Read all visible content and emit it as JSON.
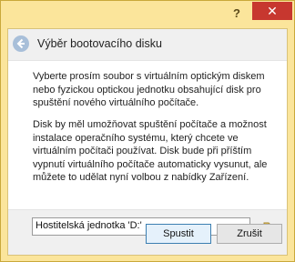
{
  "window": {
    "help_label": "?",
    "close_label": "✕"
  },
  "header": {
    "title": "Výběr bootovacího disku"
  },
  "content": {
    "paragraph1": "Vyberte prosím soubor s virtuálním optickým diskem nebo fyzickou optickou jednotku obsahující disk pro spuštění nového virtuálního počítače.",
    "paragraph2": "Disk by měl umožňovat spuštění počítače a možnost instalace operačního systému, který chcete ve virtuálním počítači používat. Disk bude při příštím vypnutí virtuálního počítače automaticky vysunut, ale můžete to udělat nyní volbou z nabídky Zařízení."
  },
  "media_select": {
    "selected": "Hostitelská jednotka 'D:'"
  },
  "buttons": {
    "start_label": "Spustit",
    "cancel_label": "Zrušit"
  },
  "colors": {
    "window_frame": "#fbe59b",
    "close_button": "#c7372f",
    "primary_border": "#3c7fb1"
  },
  "icons": {
    "back": "back-arrow-icon",
    "media_chooser": "folder-icon"
  }
}
